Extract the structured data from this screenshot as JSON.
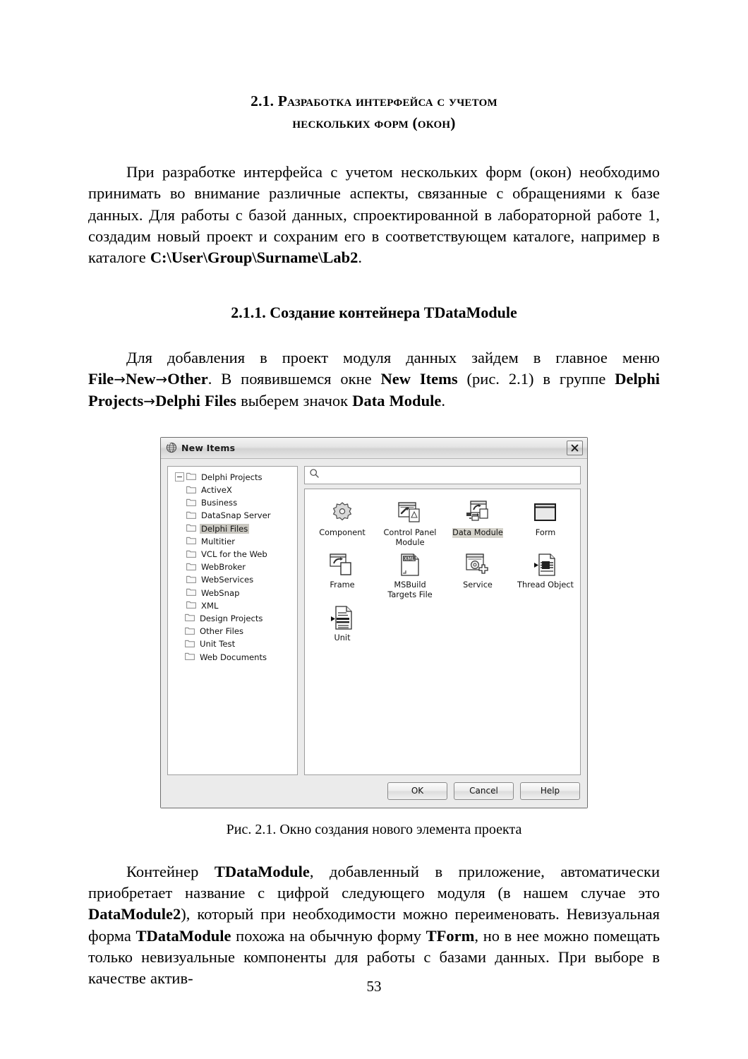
{
  "document": {
    "page_number": "53",
    "section_title_line1": "2.1. Разработка интерфейса с учетом",
    "section_title_line2": "нескольких форм (окон)",
    "paragraph_1_part1": "При разработке интерфейса с учетом нескольких форм (окон) необходимо принимать во внимание различные аспекты, связанные с обращениями к базе данных. Для работы с базой данных, спроектированной в лабораторной работе 1, создадим новый проект и сохраним его в соответствующем каталоге, например в каталоге ",
    "paragraph_1_bold": "C:\\User\\Group\\Surname\\Lab2",
    "paragraph_1_part2": ".",
    "subsection_title": "2.1.1. Создание контейнера TDataModule",
    "paragraph_2": {
      "t1": "Для добавления в проект модуля данных зайдем в главное меню ",
      "b1": "File",
      "a1": "→",
      "b2": "New",
      "a2": "→",
      "b3": "Other",
      "t2": ". В появившемся окне ",
      "b4": "New Items",
      "t3": " (рис. 2.1) в группе ",
      "b5": "Delphi Projects",
      "a3": "→",
      "b6": "Delphi Files",
      "t4": " выберем значок ",
      "b7": "Data Module",
      "t5": "."
    },
    "figure_caption": "Рис. 2.1. Окно создания нового элемента проекта",
    "paragraph_3": {
      "t1": "Контейнер ",
      "b1": "TDataModule",
      "t2": ", добавленный в приложение, автоматически приобретает название с цифрой следующего модуля (в нашем случае это ",
      "b2": "DataModule2",
      "t3": "), который при необходимости можно переименовать. Невизуальная форма ",
      "b3": "TDataModule",
      "t4": " похожа на обычную форму ",
      "b4": "TForm",
      "t5": ", но в нее можно помещать только невизуальные компоненты для работы с базами данных. При выборе в качестве актив-"
    }
  },
  "dialog": {
    "title": "New Items",
    "title_icon": "globe-icon",
    "close_icon": "close-icon",
    "search": {
      "value": "",
      "placeholder": "",
      "icon": "search-icon"
    },
    "tree": [
      {
        "label": "Delphi Projects",
        "level": 0,
        "expanded": true,
        "selected": false
      },
      {
        "label": "ActiveX",
        "level": 1,
        "expanded": false,
        "selected": false
      },
      {
        "label": "Business",
        "level": 1,
        "expanded": false,
        "selected": false
      },
      {
        "label": "DataSnap Server",
        "level": 1,
        "expanded": false,
        "selected": false
      },
      {
        "label": "Delphi Files",
        "level": 1,
        "expanded": false,
        "selected": true
      },
      {
        "label": "Multitier",
        "level": 1,
        "expanded": false,
        "selected": false
      },
      {
        "label": "VCL for the Web",
        "level": 1,
        "expanded": false,
        "selected": false
      },
      {
        "label": "WebBroker",
        "level": 1,
        "expanded": false,
        "selected": false
      },
      {
        "label": "WebServices",
        "level": 1,
        "expanded": false,
        "selected": false
      },
      {
        "label": "WebSnap",
        "level": 1,
        "expanded": false,
        "selected": false
      },
      {
        "label": "XML",
        "level": 1,
        "expanded": false,
        "selected": false
      },
      {
        "label": "Design Projects",
        "level": 0,
        "expanded": false,
        "selected": false
      },
      {
        "label": "Other Files",
        "level": 0,
        "expanded": false,
        "selected": false
      },
      {
        "label": "Unit Test",
        "level": 0,
        "expanded": false,
        "selected": false
      },
      {
        "label": "Web Documents",
        "level": 0,
        "expanded": false,
        "selected": false
      }
    ],
    "items": [
      {
        "label": "Component",
        "icon": "gear-icon",
        "selected": false
      },
      {
        "label": "Control Panel Module",
        "icon": "control-panel-icon",
        "selected": false
      },
      {
        "label": "Data Module",
        "icon": "data-module-icon",
        "selected": true
      },
      {
        "label": "Form",
        "icon": "form-icon",
        "selected": false
      },
      {
        "label": "Frame",
        "icon": "frame-icon",
        "selected": false
      },
      {
        "label": "MSBuild Targets File",
        "icon": "xml-file-icon",
        "selected": false,
        "badge": "XML"
      },
      {
        "label": "Service",
        "icon": "service-icon",
        "selected": false
      },
      {
        "label": "Thread Object",
        "icon": "thread-object-icon",
        "selected": false
      },
      {
        "label": "Unit",
        "icon": "unit-icon",
        "selected": false
      }
    ],
    "buttons": [
      {
        "label": "OK"
      },
      {
        "label": "Cancel"
      },
      {
        "label": "Help"
      }
    ]
  }
}
